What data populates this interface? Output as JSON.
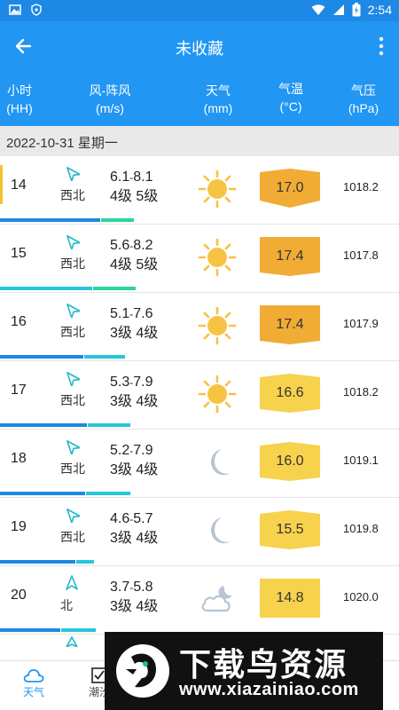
{
  "status_bar": {
    "time": "2:54"
  },
  "app_bar": {
    "title": "未收藏"
  },
  "columns": {
    "hour": [
      "小时",
      "(HH)"
    ],
    "wind": [
      "风-阵风",
      "(m/s)"
    ],
    "weather": [
      "天气",
      "(mm)"
    ],
    "temp": [
      "气温",
      "(°C)"
    ],
    "pressure": [
      "气压",
      "(hPa)"
    ]
  },
  "date_label": "2022-10-31  星期一",
  "rows": [
    {
      "hour": "14",
      "dir": "西北",
      "wind": "6.1",
      "gust": "8.1",
      "level": "4级 5级",
      "sky": "sunny",
      "temp": "17.0",
      "pressure": "1018.2",
      "selected": true
    },
    {
      "hour": "15",
      "dir": "西北",
      "wind": "5.6",
      "gust": "8.2",
      "level": "4级 5级",
      "sky": "sunny",
      "temp": "17.4",
      "pressure": "1017.8"
    },
    {
      "hour": "16",
      "dir": "西北",
      "wind": "5.1",
      "gust": "7.6",
      "level": "3级 4级",
      "sky": "sunny",
      "temp": "17.4",
      "pressure": "1017.9"
    },
    {
      "hour": "17",
      "dir": "西北",
      "wind": "5.3",
      "gust": "7.9",
      "level": "3级 4级",
      "sky": "sunny",
      "temp": "16.6",
      "pressure": "1018.2"
    },
    {
      "hour": "18",
      "dir": "西北",
      "wind": "5.2",
      "gust": "7.9",
      "level": "3级 4级",
      "sky": "night",
      "temp": "16.0",
      "pressure": "1019.1"
    },
    {
      "hour": "19",
      "dir": "西北",
      "wind": "4.6",
      "gust": "5.7",
      "level": "3级 4级",
      "sky": "night",
      "temp": "15.5",
      "pressure": "1019.8"
    },
    {
      "hour": "20",
      "dir": "北",
      "wind": "3.7",
      "gust": "5.8",
      "level": "3级 4级",
      "sky": "cloudy-night",
      "temp": "14.8",
      "pressure": "1020.0"
    }
  ],
  "bottom_nav": [
    {
      "label": "天气",
      "icon": "cloud-icon",
      "active": true
    },
    {
      "label": "潮汐",
      "icon": "checkbox-icon",
      "active": false
    }
  ],
  "watermark": {
    "title": "下载鸟资源",
    "url": "www.xiazainiao.com"
  },
  "colors": {
    "primary": "#2196f3",
    "warm_high": "#f0ac35",
    "warm_low": "#f7d24c",
    "bar_blue": "#1e88e5",
    "bar_cyan": "#26c6da",
    "bar_green": "#2bd4a3"
  }
}
